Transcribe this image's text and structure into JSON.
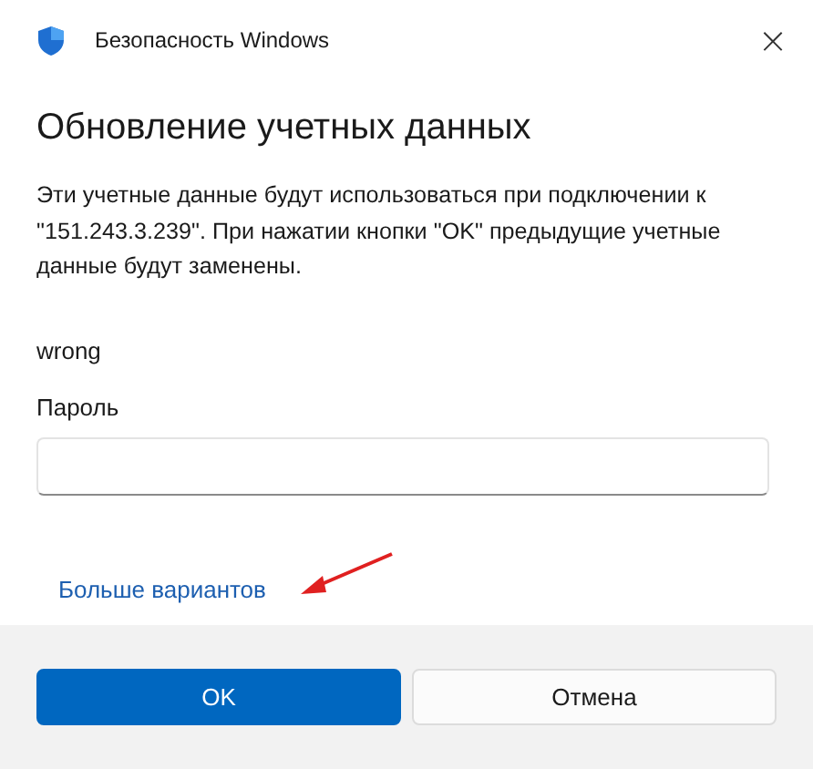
{
  "window": {
    "title": "Безопасность Windows",
    "close": "×"
  },
  "heading": "Обновление учетных данных",
  "description": "Эти учетные данные будут использоваться при подключении к \"151.243.3.239\". При нажатии кнопки \"OK\" предыдущие учетные данные будут заменены.",
  "username": "wrong",
  "password": {
    "label": "Пароль"
  },
  "more_link": "Больше вариантов",
  "annotation": {
    "kind": "arrow"
  },
  "buttons": [
    {
      "label": "OK",
      "primary": true
    },
    {
      "label": "Отмена",
      "primary": false
    }
  ]
}
